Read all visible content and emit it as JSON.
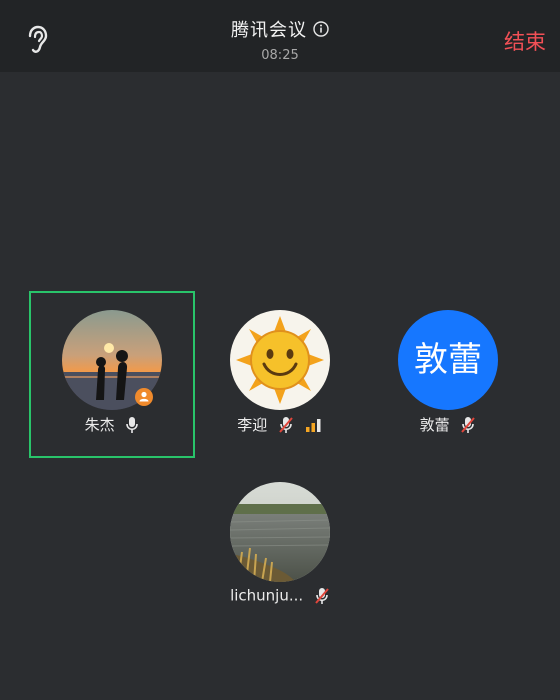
{
  "header": {
    "title": "腾讯会议",
    "time": "08:25",
    "end_label": "结束"
  },
  "participants": [
    {
      "name": "朱杰",
      "mic": "on",
      "host": true,
      "selected": true,
      "avatar_icon": "sunset-couple-photo"
    },
    {
      "name": "李迎",
      "mic": "muted",
      "signal": true,
      "avatar_icon": "smiling-sun-photo"
    },
    {
      "name": "敦蕾",
      "mic": "muted",
      "avatar_text": "敦蕾",
      "avatar_color": "#1677ff"
    },
    {
      "name": "lichunju...",
      "mic": "muted",
      "avatar_icon": "lakeshore-photo"
    }
  ],
  "colors": {
    "background": "#2b2d30",
    "header": "#222426",
    "end": "#f25056",
    "selected_border": "#29c46a",
    "host_badge": "#f08a2c",
    "muted": "#e0463c",
    "signal": "#f5a623"
  }
}
